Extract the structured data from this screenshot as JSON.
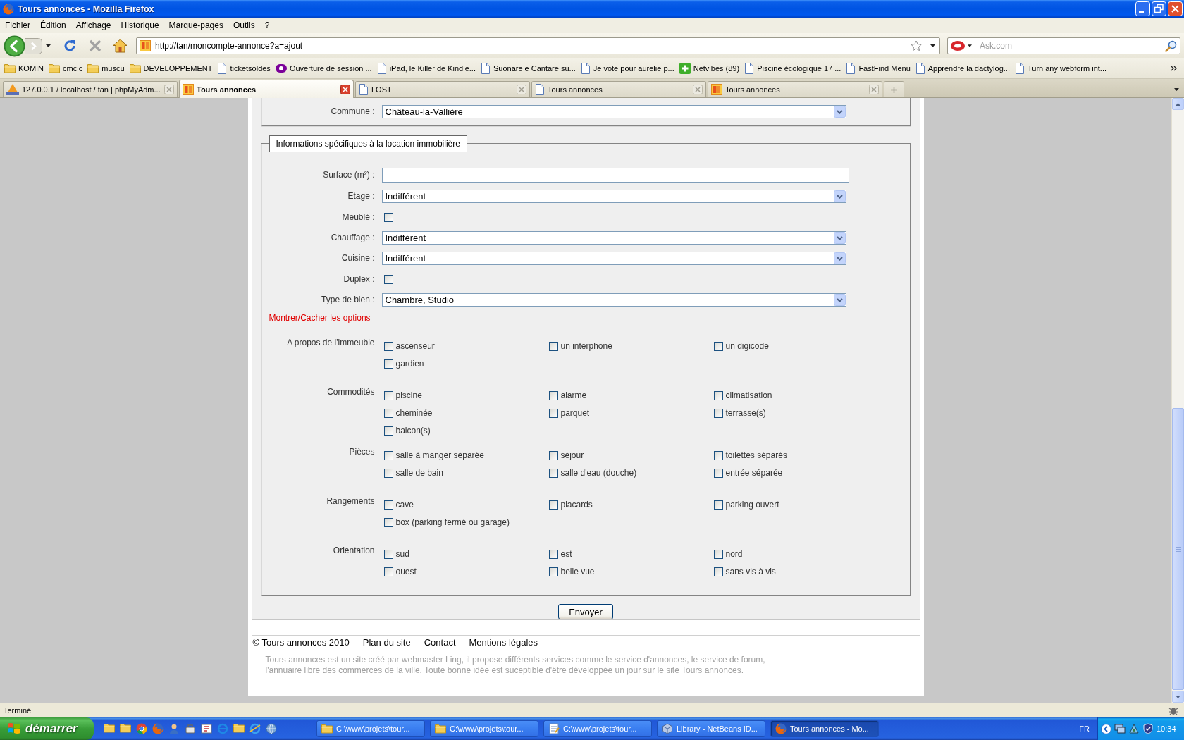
{
  "window": {
    "title": "Tours annonces - Mozilla Firefox"
  },
  "menu_bar": [
    "Fichier",
    "Édition",
    "Affichage",
    "Historique",
    "Marque-pages",
    "Outils",
    "?"
  ],
  "nav_toolbar": {
    "url": "http://tan/moncompte-annonce?a=ajout",
    "search": {
      "placeholder": "Ask.com"
    }
  },
  "bookmarks": [
    {
      "kind": "folder",
      "label": "KOMIN"
    },
    {
      "kind": "folder",
      "label": "cmcic"
    },
    {
      "kind": "folder",
      "label": "muscu"
    },
    {
      "kind": "folder",
      "label": "DEVELOPPEMENT"
    },
    {
      "kind": "page",
      "label": "ticketsoldes"
    },
    {
      "kind": "yahoo",
      "label": "Ouverture de session ..."
    },
    {
      "kind": "page",
      "label": "iPad, le Killer de Kindle..."
    },
    {
      "kind": "page",
      "label": "Suonare e Cantare su..."
    },
    {
      "kind": "page",
      "label": "Je vote pour aurelie p..."
    },
    {
      "kind": "plus",
      "label": "Netvibes (89)"
    },
    {
      "kind": "page",
      "label": "Piscine écologique 17 ..."
    },
    {
      "kind": "page",
      "label": "FastFind Menu"
    },
    {
      "kind": "page",
      "label": "Apprendre la dactylog..."
    },
    {
      "kind": "page",
      "label": "Turn any webform int..."
    }
  ],
  "tabs": [
    {
      "kind": "pma",
      "label": "127.0.0.1 / localhost / tan | phpMyAdm...",
      "selected": false
    },
    {
      "kind": "ts",
      "label": "Tours annonces",
      "selected": true
    },
    {
      "kind": "page",
      "label": "LOST",
      "selected": false
    },
    {
      "kind": "page",
      "label": "Tours annonces",
      "selected": false
    },
    {
      "kind": "ts",
      "label": "Tours annonces",
      "selected": false
    }
  ],
  "page": {
    "commune": {
      "label": "Commune :",
      "value": "Château-la-Vallière"
    },
    "specific": {
      "legend": "Informations spécifiques à la location immobilière",
      "fields": [
        {
          "kind": "text",
          "label": "Surface (m²) :"
        },
        {
          "kind": "select",
          "label": "Etage :",
          "value": "Indifférent"
        },
        {
          "kind": "checkbox",
          "label": "Meublé :",
          "checked": false
        },
        {
          "kind": "select",
          "label": "Chauffage :",
          "value": "Indifférent"
        },
        {
          "kind": "select",
          "label": "Cuisine :",
          "value": "Indifférent"
        },
        {
          "kind": "checkbox",
          "label": "Duplex :",
          "checked": false
        },
        {
          "kind": "select",
          "label": "Type de bien :",
          "value": "Chambre, Studio"
        }
      ],
      "toggle_link": "Montrer/Cacher les options",
      "option_groups": [
        {
          "label": "A propos de l'immeuble",
          "options": [
            {
              "label": "ascenseur",
              "checked": false
            },
            {
              "label": "un interphone",
              "checked": false
            },
            {
              "label": "un digicode",
              "checked": false
            },
            {
              "label": "gardien",
              "checked": false
            }
          ]
        },
        {
          "label": "Commodités",
          "options": [
            {
              "label": "piscine",
              "checked": false
            },
            {
              "label": "alarme",
              "checked": false
            },
            {
              "label": "climatisation",
              "checked": false
            },
            {
              "label": "cheminée",
              "checked": false
            },
            {
              "label": "parquet",
              "checked": false
            },
            {
              "label": "terrasse(s)",
              "checked": false
            },
            {
              "label": "balcon(s)",
              "checked": false
            }
          ]
        },
        {
          "label": "Pièces",
          "options": [
            {
              "label": "salle à manger séparée",
              "checked": false
            },
            {
              "label": "séjour",
              "checked": false
            },
            {
              "label": "toilettes séparés",
              "checked": false
            },
            {
              "label": "salle de bain",
              "checked": false
            },
            {
              "label": "salle d'eau (douche)",
              "checked": false
            },
            {
              "label": "entrée séparée",
              "checked": false
            }
          ]
        },
        {
          "label": "Rangements",
          "options": [
            {
              "label": "cave",
              "checked": false
            },
            {
              "label": "placards",
              "checked": false
            },
            {
              "label": "parking ouvert",
              "checked": false
            },
            {
              "label": "box (parking fermé ou garage)",
              "checked": false
            }
          ]
        },
        {
          "label": "Orientation",
          "options": [
            {
              "label": "sud",
              "checked": false
            },
            {
              "label": "est",
              "checked": false
            },
            {
              "label": "nord",
              "checked": false
            },
            {
              "label": "ouest",
              "checked": false
            },
            {
              "label": "belle vue",
              "checked": false
            },
            {
              "label": "sans vis à vis",
              "checked": false
            }
          ]
        }
      ]
    },
    "submit": "Envoyer",
    "footer": {
      "copyright": "© Tours annonces 2010",
      "links": [
        "Plan du site",
        "Contact",
        "Mentions légales"
      ],
      "description_lines": [
        "Tours annonces est un site créé par webmaster Ling, il propose différents services comme le service d'annonces, le service de forum,",
        "l'annuaire libre des commerces de la ville. Toute bonne idée est suceptible d'être développée un jour sur le site Tours annonces."
      ]
    }
  },
  "status_bar": {
    "text": "Terminé"
  },
  "taskbar": {
    "start": "démarrer",
    "tasks": [
      {
        "kind": "folder",
        "label": "C:\\www\\projets\\tour...",
        "selected": false
      },
      {
        "kind": "folder",
        "label": "C:\\www\\projets\\tour...",
        "selected": false
      },
      {
        "kind": "editor",
        "label": "C:\\www\\projets\\tour...",
        "selected": false
      },
      {
        "kind": "cube",
        "label": "Library - NetBeans ID...",
        "selected": false
      },
      {
        "kind": "firefox",
        "label": "Tours annonces - Mo...",
        "selected": true
      }
    ],
    "language": "FR",
    "clock": "10:34"
  }
}
